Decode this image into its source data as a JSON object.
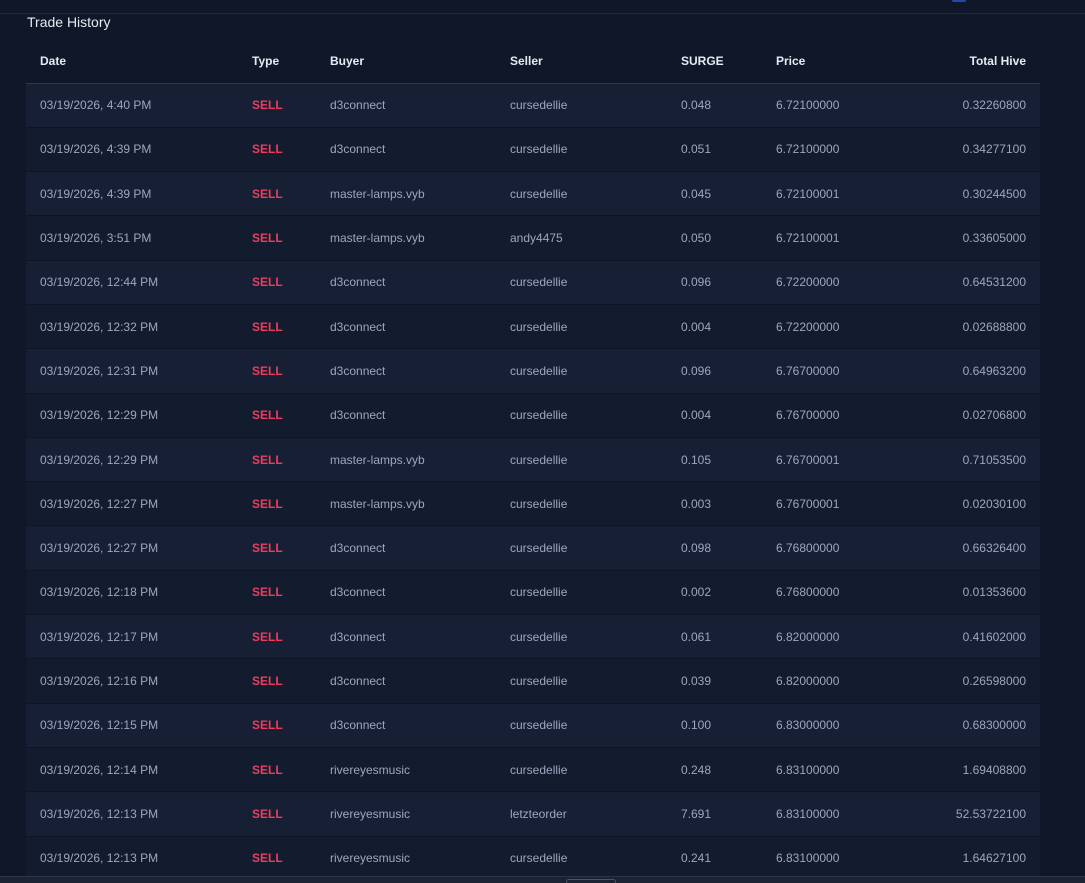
{
  "panel": {
    "title": "Trade History"
  },
  "columns": [
    "Date",
    "Type",
    "Buyer",
    "Seller",
    "SURGE",
    "Price",
    "Total Hive"
  ],
  "rows": [
    [
      "03/19/2026, 4:40 PM",
      "SELL",
      "d3connect",
      "cursedellie",
      "0.048",
      "6.72100000",
      "0.32260800"
    ],
    [
      "03/19/2026, 4:39 PM",
      "SELL",
      "d3connect",
      "cursedellie",
      "0.051",
      "6.72100000",
      "0.34277100"
    ],
    [
      "03/19/2026, 4:39 PM",
      "SELL",
      "master-lamps.vyb",
      "cursedellie",
      "0.045",
      "6.72100001",
      "0.30244500"
    ],
    [
      "03/19/2026, 3:51 PM",
      "SELL",
      "master-lamps.vyb",
      "andy4475",
      "0.050",
      "6.72100001",
      "0.33605000"
    ],
    [
      "03/19/2026, 12:44 PM",
      "SELL",
      "d3connect",
      "cursedellie",
      "0.096",
      "6.72200000",
      "0.64531200"
    ],
    [
      "03/19/2026, 12:32 PM",
      "SELL",
      "d3connect",
      "cursedellie",
      "0.004",
      "6.72200000",
      "0.02688800"
    ],
    [
      "03/19/2026, 12:31 PM",
      "SELL",
      "d3connect",
      "cursedellie",
      "0.096",
      "6.76700000",
      "0.64963200"
    ],
    [
      "03/19/2026, 12:29 PM",
      "SELL",
      "d3connect",
      "cursedellie",
      "0.004",
      "6.76700000",
      "0.02706800"
    ],
    [
      "03/19/2026, 12:29 PM",
      "SELL",
      "master-lamps.vyb",
      "cursedellie",
      "0.105",
      "6.76700001",
      "0.71053500"
    ],
    [
      "03/19/2026, 12:27 PM",
      "SELL",
      "master-lamps.vyb",
      "cursedellie",
      "0.003",
      "6.76700001",
      "0.02030100"
    ],
    [
      "03/19/2026, 12:27 PM",
      "SELL",
      "d3connect",
      "cursedellie",
      "0.098",
      "6.76800000",
      "0.66326400"
    ],
    [
      "03/19/2026, 12:18 PM",
      "SELL",
      "d3connect",
      "cursedellie",
      "0.002",
      "6.76800000",
      "0.01353600"
    ],
    [
      "03/19/2026, 12:17 PM",
      "SELL",
      "d3connect",
      "cursedellie",
      "0.061",
      "6.82000000",
      "0.41602000"
    ],
    [
      "03/19/2026, 12:16 PM",
      "SELL",
      "d3connect",
      "cursedellie",
      "0.039",
      "6.82000000",
      "0.26598000"
    ],
    [
      "03/19/2026, 12:15 PM",
      "SELL",
      "d3connect",
      "cursedellie",
      "0.100",
      "6.83000000",
      "0.68300000"
    ],
    [
      "03/19/2026, 12:14 PM",
      "SELL",
      "rivereyesmusic",
      "cursedellie",
      "0.248",
      "6.83100000",
      "1.69408800"
    ],
    [
      "03/19/2026, 12:13 PM",
      "SELL",
      "rivereyesmusic",
      "letzteorder",
      "7.691",
      "6.83100000",
      "52.53722100"
    ],
    [
      "03/19/2026, 12:13 PM",
      "SELL",
      "rivereyesmusic",
      "cursedellie",
      "0.241",
      "6.83100000",
      "1.64627100"
    ]
  ],
  "colors": {
    "background": "#0f1729",
    "row_odd": "#161f33",
    "row_even": "#131c2f",
    "sell": "#ef3b5d",
    "text_muted": "#9aa8bf",
    "text_header": "#e6ebf2"
  }
}
